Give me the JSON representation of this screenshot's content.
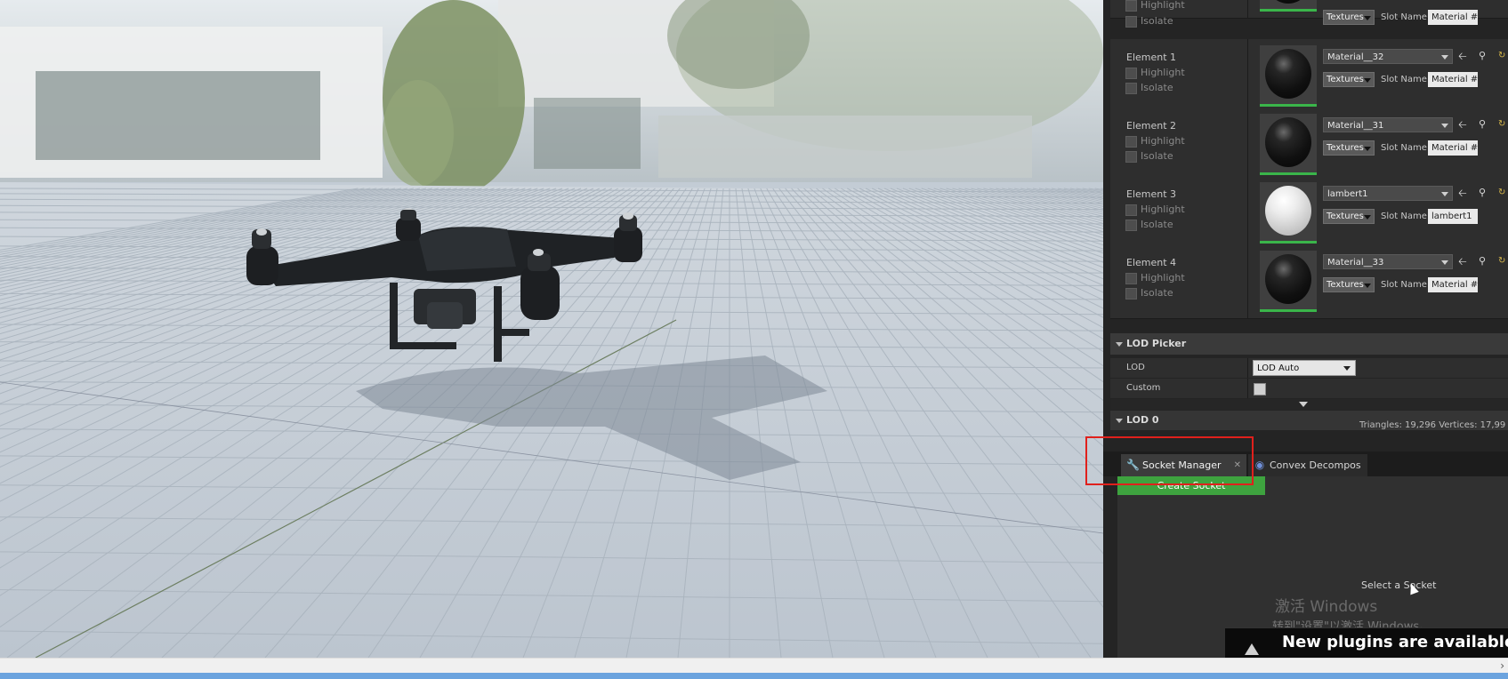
{
  "materials": [
    {
      "element_label": "",
      "highlight_label": "Highlight",
      "isolate_label": "Isolate",
      "material_name": "",
      "textures_label": "Textures",
      "slot_label": "Slot Name",
      "slot_value": "Material #",
      "sphere": "black"
    },
    {
      "element_label": "Element 1",
      "highlight_label": "Highlight",
      "isolate_label": "Isolate",
      "material_name": "Material__32",
      "textures_label": "Textures",
      "slot_label": "Slot Name",
      "slot_value": "Material #",
      "sphere": "black"
    },
    {
      "element_label": "Element 2",
      "highlight_label": "Highlight",
      "isolate_label": "Isolate",
      "material_name": "Material__31",
      "textures_label": "Textures",
      "slot_label": "Slot Name",
      "slot_value": "Material #",
      "sphere": "black"
    },
    {
      "element_label": "Element 3",
      "highlight_label": "Highlight",
      "isolate_label": "Isolate",
      "material_name": "lambert1",
      "textures_label": "Textures",
      "slot_label": "Slot Name",
      "slot_value": "lambert1",
      "sphere": "white"
    },
    {
      "element_label": "Element 4",
      "highlight_label": "Highlight",
      "isolate_label": "Isolate",
      "material_name": "Material__33",
      "textures_label": "Textures",
      "slot_label": "Slot Name",
      "slot_value": "Material #",
      "sphere": "black"
    }
  ],
  "lod_picker": {
    "title": "LOD Picker",
    "lod_label": "LOD",
    "lod_value": "LOD Auto",
    "custom_label": "Custom"
  },
  "lod0": {
    "title": "LOD 0",
    "stats": "Triangles: 19,296   Vertices: 17,99"
  },
  "tabs": [
    {
      "label": "Socket Manager",
      "icon": "wrench-icon",
      "active": true
    },
    {
      "label": "Convex Decompos",
      "icon": "globe-icon",
      "active": false
    }
  ],
  "socket": {
    "create_label": "Create Socket",
    "empty_label": "Select a Socket"
  },
  "watermark": {
    "line1": "激活 Windows",
    "line2": "转到\"设置\"以激活 Windows。"
  },
  "notification": {
    "text": "New plugins are available"
  },
  "colors": {
    "accent_green": "#3ea33f",
    "highlight_red": "#e0201c",
    "taskbar_blue": "#6ba3de"
  }
}
